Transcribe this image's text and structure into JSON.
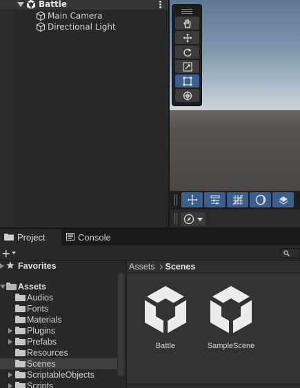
{
  "hierarchy": {
    "scene_name": "Battle",
    "items": [
      {
        "label": "Main Camera",
        "icon": "cube-icon"
      },
      {
        "label": "Directional Light",
        "icon": "cube-icon"
      }
    ]
  },
  "scene_view": {
    "tools": [
      "hand-tool",
      "move-tool",
      "rotate-tool",
      "scale-tool",
      "rect-tool",
      "transform-tool"
    ],
    "active_tool": "rect-tool",
    "overlay_buttons": [
      "move-snap",
      "grid-settings",
      "grid-visibility",
      "shading-mode",
      "layers"
    ]
  },
  "tabs": {
    "project": "Project",
    "console": "Console"
  },
  "toolbar": {
    "add": "+"
  },
  "tree": {
    "favorites": "Favorites",
    "assets": "Assets",
    "folders": [
      {
        "label": "Audios",
        "expandable": false,
        "selected": false
      },
      {
        "label": "Fonts",
        "expandable": false,
        "selected": false
      },
      {
        "label": "Materials",
        "expandable": false,
        "selected": false
      },
      {
        "label": "Plugins",
        "expandable": true,
        "selected": false
      },
      {
        "label": "Prefabs",
        "expandable": true,
        "selected": false
      },
      {
        "label": "Resources",
        "expandable": false,
        "selected": false
      },
      {
        "label": "Scenes",
        "expandable": false,
        "selected": true
      },
      {
        "label": "ScriptableObjects",
        "expandable": true,
        "selected": false
      },
      {
        "label": "Scripts",
        "expandable": true,
        "selected": false
      }
    ]
  },
  "breadcrumb": {
    "root": "Assets",
    "current": "Scenes"
  },
  "assets": [
    {
      "label": "Battle",
      "icon": "unity-scene-icon"
    },
    {
      "label": "SampleScene",
      "icon": "unity-scene-icon"
    }
  ],
  "colors": {
    "accent": "#3a5f8c",
    "panel": "#282828",
    "sky": "#7f98ae"
  }
}
